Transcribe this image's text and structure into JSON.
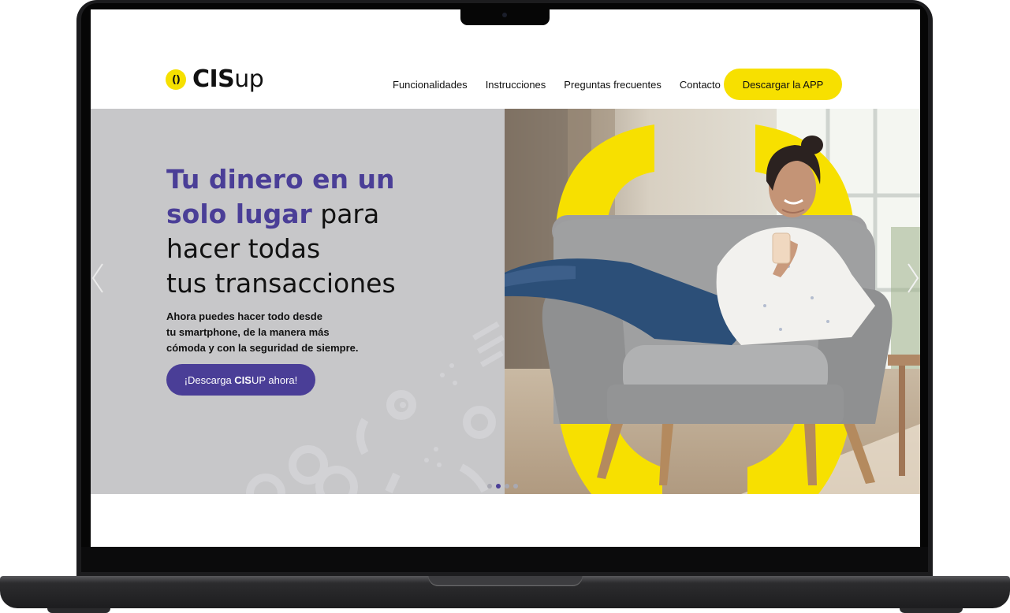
{
  "brand": {
    "logo_mark": "()",
    "logo_bold": "CIS",
    "logo_light": "UP"
  },
  "nav": {
    "items": [
      {
        "label": "Funcionalidades"
      },
      {
        "label": "Instrucciones"
      },
      {
        "label": "Preguntas frecuentes"
      },
      {
        "label": "Contacto"
      }
    ],
    "download_button": "Descargar la APP"
  },
  "hero": {
    "title_highlight_1": "Tu dinero en un",
    "title_highlight_2": "solo lugar",
    "title_rest_1": " para",
    "title_rest_2": "hacer todas",
    "title_rest_3": "tus transacciones",
    "subtitle_1": "Ahora puedes hacer todo desde",
    "subtitle_2": "tu smartphone, de la manera más",
    "subtitle_3": "cómoda y con la seguridad de siempre.",
    "cta_prefix": "¡Descarga ",
    "cta_bold": "CIS",
    "cta_suffix": "UP ahora!"
  },
  "carousel": {
    "slide_count": 4,
    "active_slide": 2
  },
  "colors": {
    "brand_yellow": "#f7e000",
    "brand_purple": "#4a3e97",
    "hero_gray": "#c7c7c9"
  },
  "icons": {
    "prev": "chevron-left-icon",
    "next": "chevron-right-icon",
    "logo": "cisup-logo-icon"
  }
}
